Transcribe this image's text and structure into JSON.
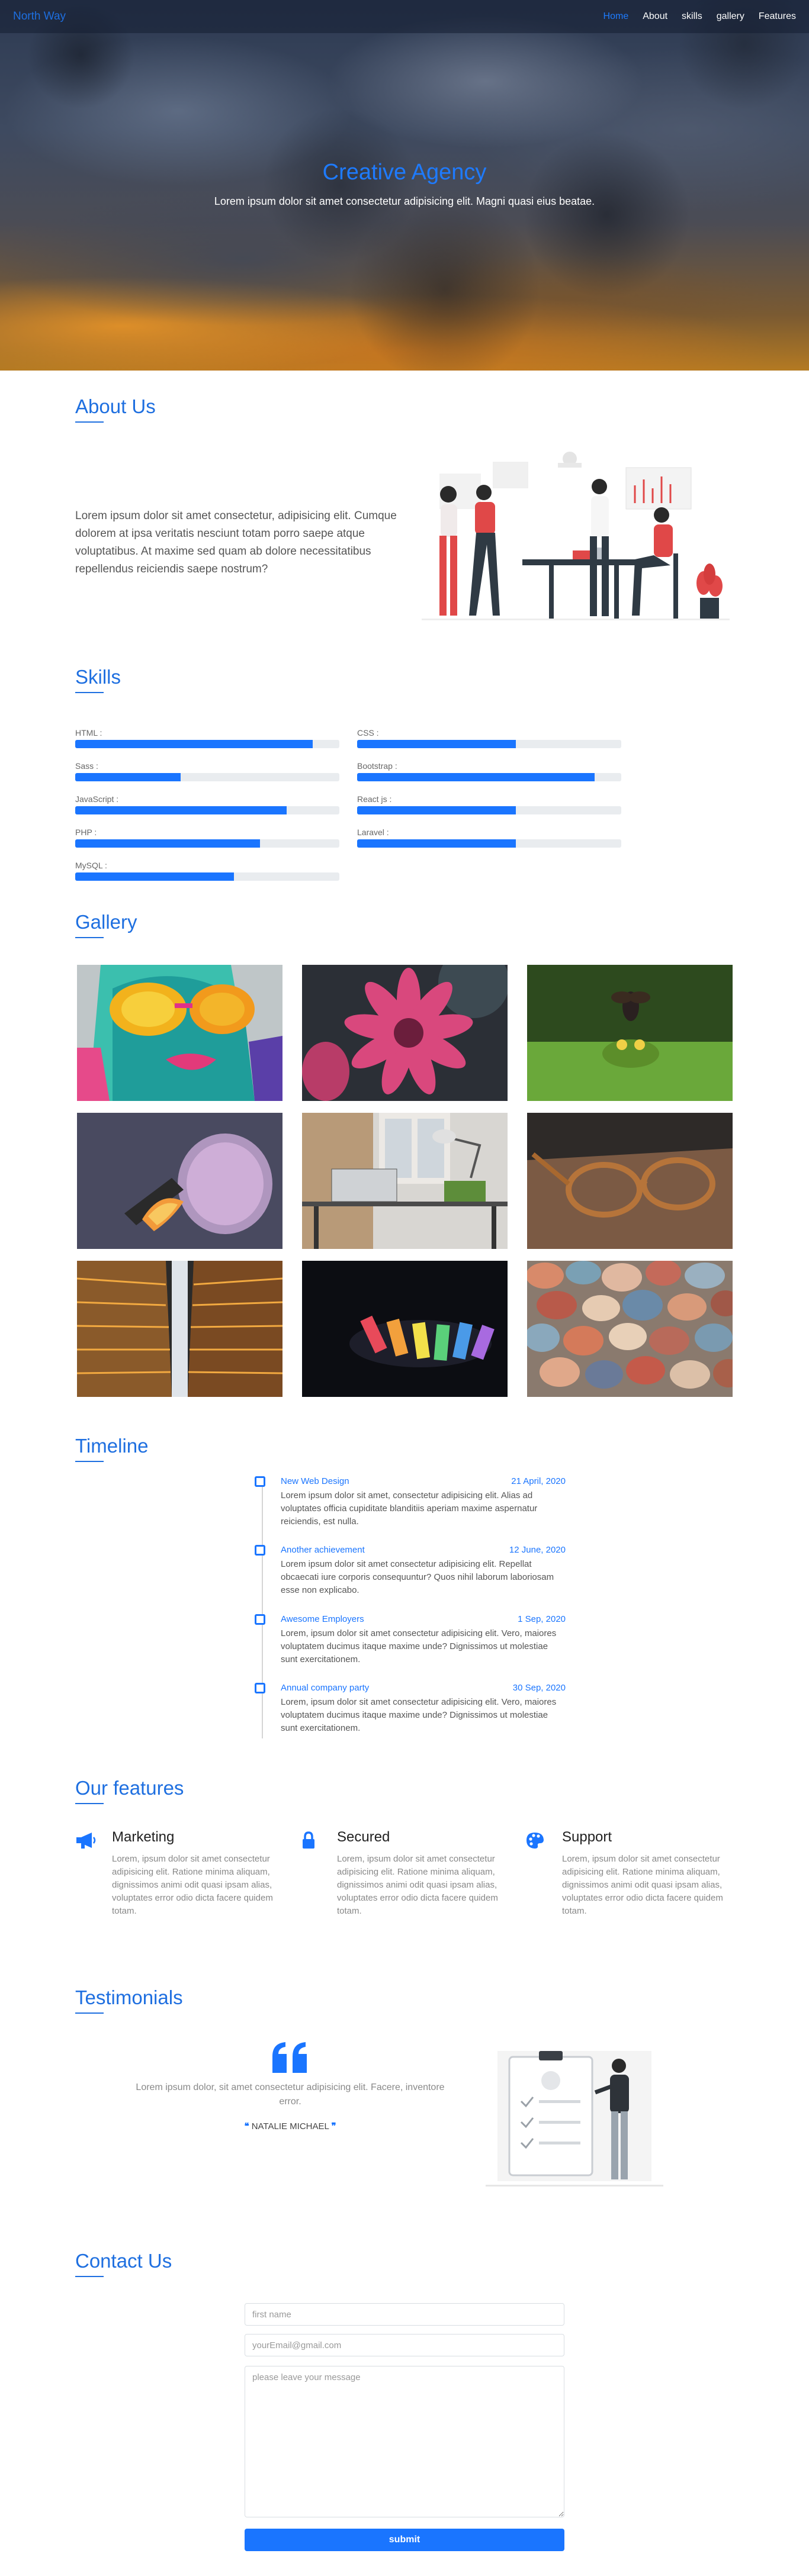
{
  "nav": {
    "brand": "North Way",
    "links": [
      {
        "label": "Home",
        "active": true
      },
      {
        "label": "About"
      },
      {
        "label": "skills"
      },
      {
        "label": "gallery"
      },
      {
        "label": "Features"
      }
    ]
  },
  "hero": {
    "title": "Creative Agency",
    "subtitle": "Lorem ipsum dolor sit amet consectetur adipisicing elit. Magni quasi eius beatae."
  },
  "about": {
    "title": "About Us",
    "text": "Lorem ipsum dolor sit amet consectetur, adipisicing elit. Cumque dolorem at ipsa veritatis nesciunt totam porro saepe atque voluptatibus. At maxime sed quam ab dolore necessitatibus repellendus reiciendis saepe nostrum?"
  },
  "skills": {
    "title": "Skills",
    "items": [
      {
        "label": "HTML :",
        "level": 0.9
      },
      {
        "label": "CSS :",
        "level": 0.6
      },
      {
        "label": "Sass :",
        "level": 0.4
      },
      {
        "label": "Bootstrap :",
        "level": 0.9
      },
      {
        "label": "JavaScript :",
        "level": 0.8
      },
      {
        "label": "React js :",
        "level": 0.6
      },
      {
        "label": "PHP :",
        "level": 0.7
      },
      {
        "label": "Laravel :",
        "level": 0.6
      },
      {
        "label": "MySQL :",
        "level": 0.6
      }
    ]
  },
  "gallery": {
    "title": "Gallery"
  },
  "timeline": {
    "title": "Timeline",
    "items": [
      {
        "title": "New Web Design",
        "date": "21 April, 2020",
        "body": "Lorem ipsum dolor sit amet, consectetur adipisicing elit. Alias ad voluptates officia cupiditate blanditiis aperiam maxime aspernatur reiciendis, est nulla."
      },
      {
        "title": "Another achievement",
        "date": "12 June, 2020",
        "body": "Lorem ipsum dolor sit amet consectetur adipisicing elit. Repellat obcaecati iure corporis consequuntur? Quos nihil laborum laboriosam esse non explicabo."
      },
      {
        "title": "Awesome Employers",
        "date": "1 Sep, 2020",
        "body": "Lorem, ipsum dolor sit amet consectetur adipisicing elit. Vero, maiores voluptatem ducimus itaque maxime unde? Dignissimos ut molestiae sunt exercitationem."
      },
      {
        "title": "Annual company party",
        "date": "30 Sep, 2020",
        "body": "Lorem, ipsum dolor sit amet consectetur adipisicing elit. Vero, maiores voluptatem ducimus itaque maxime unde? Dignissimos ut molestiae sunt exercitationem."
      }
    ]
  },
  "features": {
    "title": "Our features",
    "items": [
      {
        "title": "Marketing",
        "icon": "megaphone-icon",
        "body": "Lorem, ipsum dolor sit amet consectetur adipisicing elit. Ratione minima aliquam, dignissimos animi odit quasi ipsam alias, voluptates error odio dicta facere quidem totam."
      },
      {
        "title": "Secured",
        "icon": "lock-icon",
        "body": "Lorem, ipsum dolor sit amet consectetur adipisicing elit. Ratione minima aliquam, dignissimos animi odit quasi ipsam alias, voluptates error odio dicta facere quidem totam."
      },
      {
        "title": "Support",
        "icon": "palette-icon",
        "body": "Lorem, ipsum dolor sit amet consectetur adipisicing elit. Ratione minima aliquam, dignissimos animi odit quasi ipsam alias, voluptates error odio dicta facere quidem totam."
      }
    ]
  },
  "testimonials": {
    "title": "Testimonials",
    "text": "Lorem ipsum dolor, sit amet consectetur adipisicing elit. Facere, inventore error.",
    "name": "NATALIE MICHAEL"
  },
  "contact": {
    "title": "Contact Us",
    "name_placeholder": "first name",
    "email_placeholder": "yourEmail@gmail.com",
    "message_placeholder": "please leave your message",
    "submit_label": "submit"
  },
  "colors": {
    "accent": "#1a75ff",
    "heading": "#1e6fe0",
    "skill_track": "#e9ecef"
  }
}
